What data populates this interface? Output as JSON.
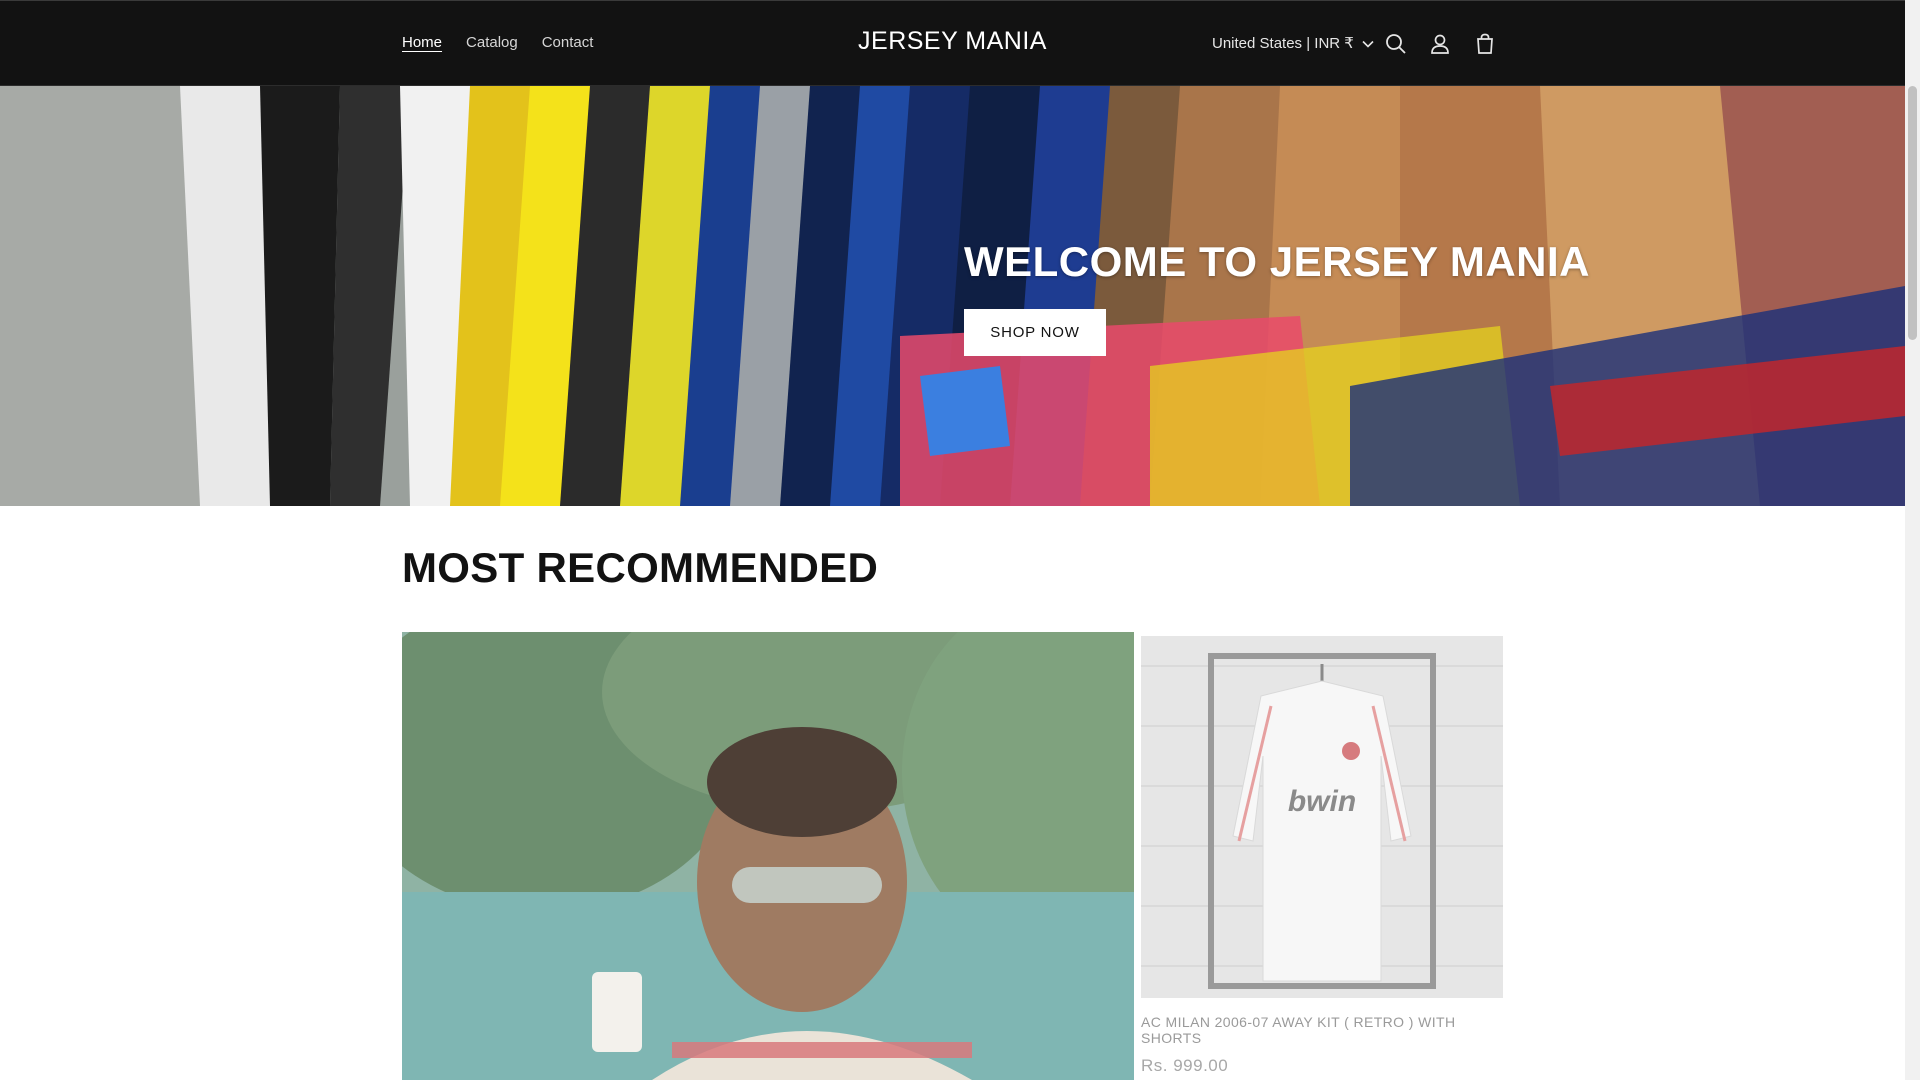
{
  "header": {
    "nav": [
      "Home",
      "Catalog",
      "Contact"
    ],
    "brand": "JERSEY MANIA",
    "country_selector": "United States | INR ₹",
    "icons": [
      "search-icon",
      "account-icon",
      "cart-icon"
    ]
  },
  "hero": {
    "title": "WELCOME TO JERSEY MANIA",
    "button": "SHOP NOW"
  },
  "section": {
    "title": "MOST RECOMMENDED"
  },
  "product": {
    "title": "AC MILAN 2006-07 AWAY KIT ( RETRO ) WITH SHORTS",
    "price": "Rs. 999.00",
    "jersey_sponsor": "bwin"
  },
  "colors": {
    "header_bg": "#121212",
    "accent": "#ffffff"
  }
}
